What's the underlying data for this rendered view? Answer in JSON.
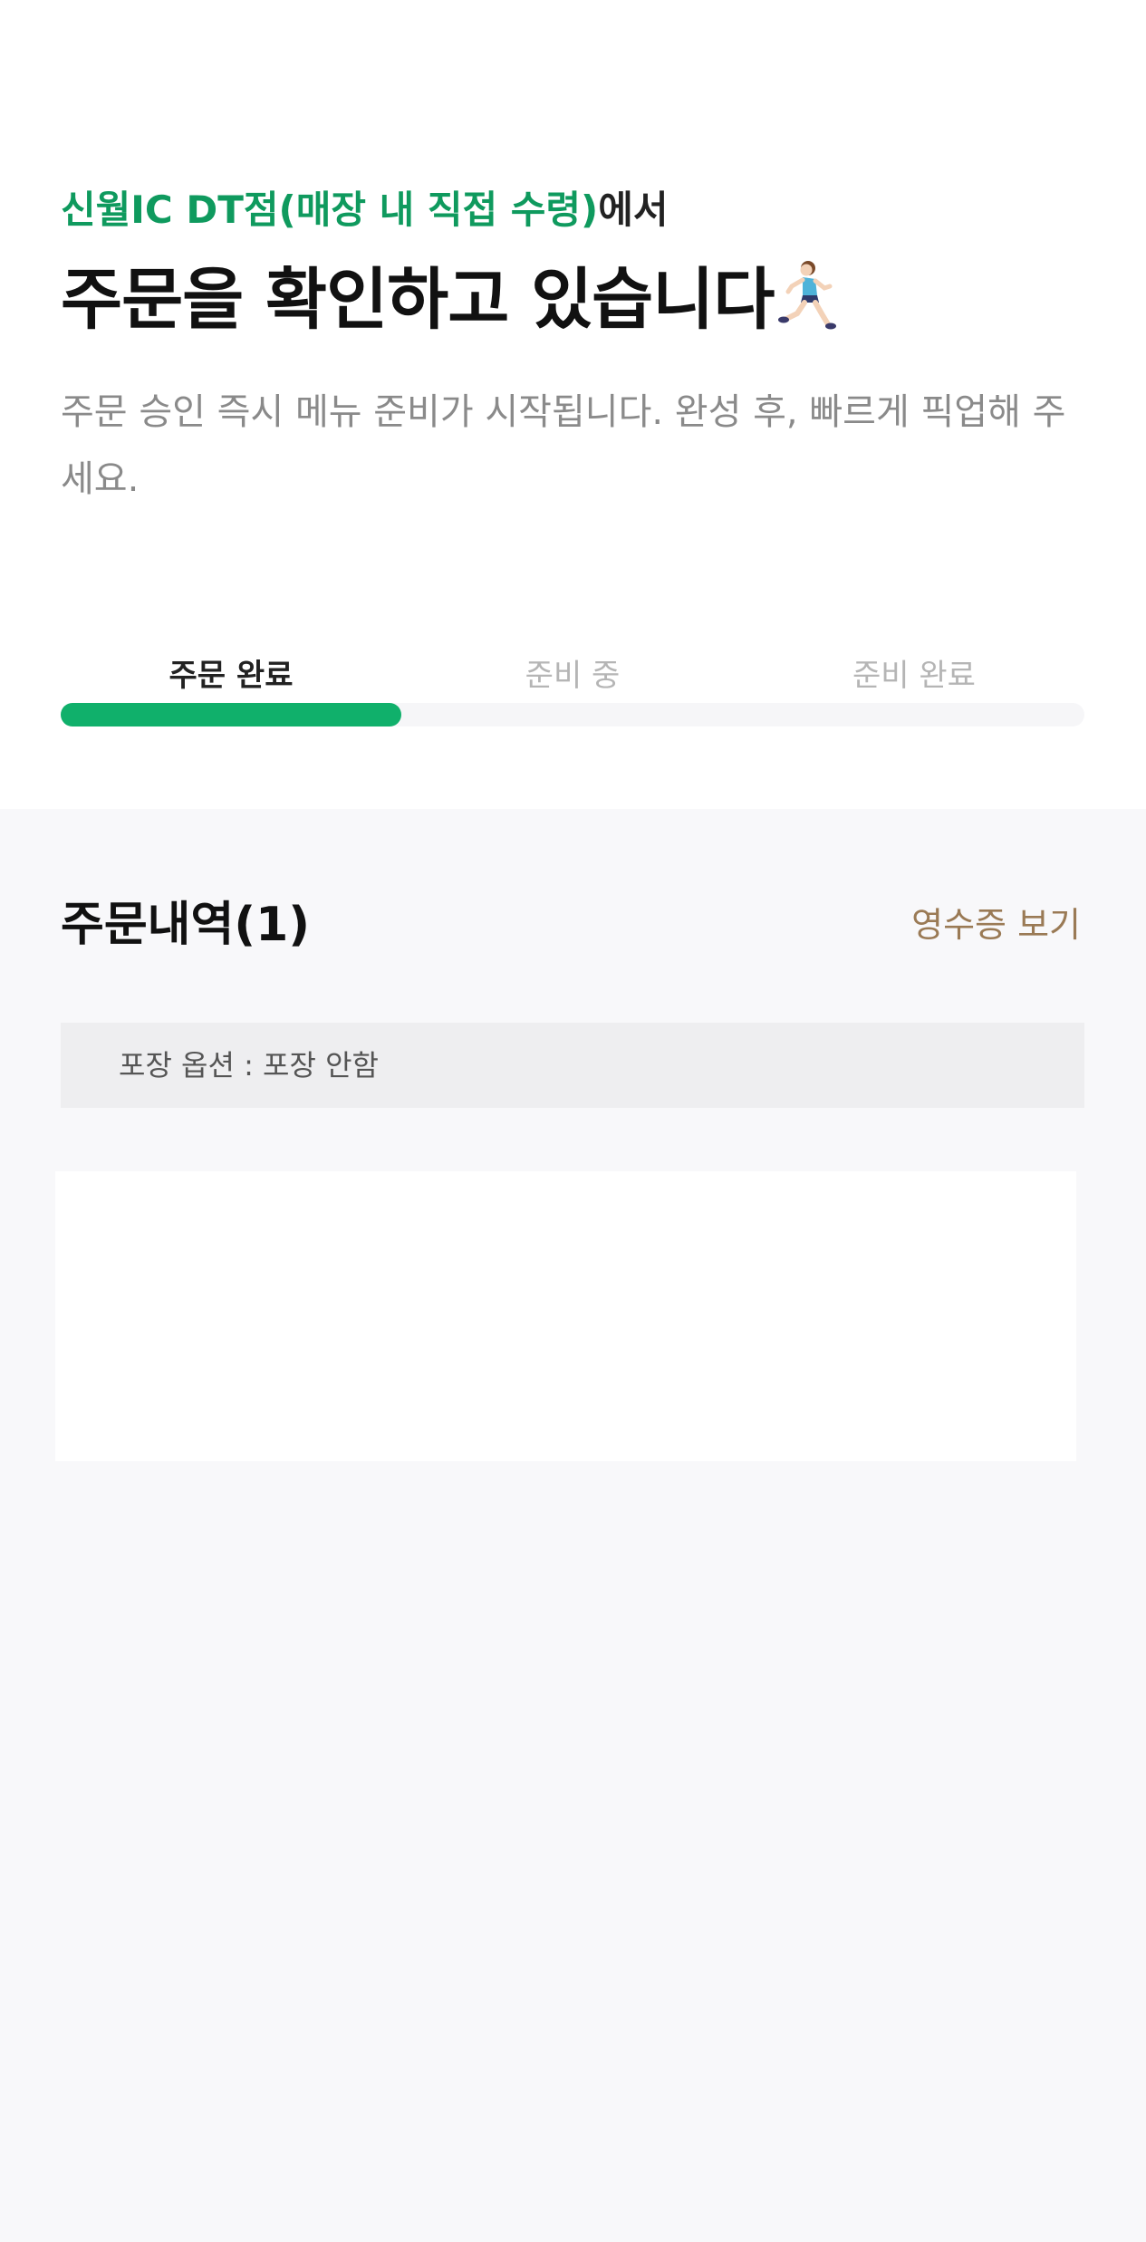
{
  "header": {
    "store_name": "신월IC DT점(매장 내 직접 수령)",
    "store_suffix": "에서",
    "title": "주문을 확인하고 있습니다",
    "title_icon": "runner-icon",
    "subtitle": "주문 승인 즉시 메뉴 준비가 시작됩니다. 완성 후, 빠르게 픽업해 주세요."
  },
  "progress": {
    "steps": [
      {
        "label": "주문 완료",
        "active": true
      },
      {
        "label": "준비 중",
        "active": false
      },
      {
        "label": "준비 완료",
        "active": false
      }
    ],
    "fraction_complete": 0.333,
    "fill_color": "#10b06b"
  },
  "order": {
    "section_title": "주문내역(1)",
    "receipt_label": "영수증 보기",
    "option_text": "포장 옵션 : 포장 안함"
  },
  "colors": {
    "accent_green": "#0f9a5e",
    "receipt_link": "#9a7a55"
  }
}
